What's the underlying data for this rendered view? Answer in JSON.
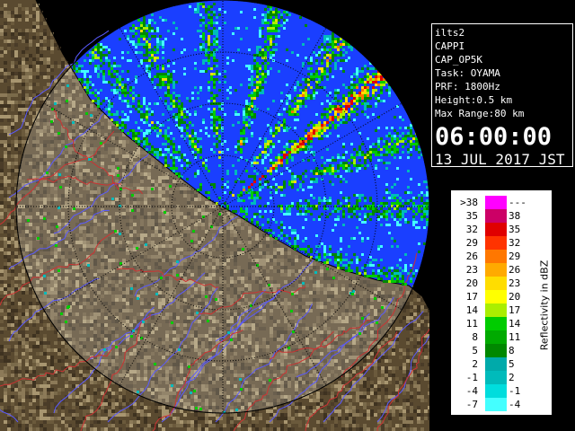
{
  "radar_site": "ilts2",
  "info_panel": {
    "lines": [
      "ilts2",
      "CAPPI",
      "CAP_OP5K",
      "Task: OYAMA",
      "PRF: 1800Hz",
      "Height:0.5 km",
      "Max Range:80 km"
    ],
    "time": "06:00:00",
    "date": "13 JUL 2017 JST"
  },
  "legend": {
    "title": "Reflectivity in dBZ",
    "bins": [
      {
        "low": ">38",
        "high": "---",
        "color": "#ff00ff"
      },
      {
        "low": "35",
        "high": "38",
        "color": "#cc0066"
      },
      {
        "low": "32",
        "high": "35",
        "color": "#e00000"
      },
      {
        "low": "29",
        "high": "32",
        "color": "#ff3300"
      },
      {
        "low": "26",
        "high": "29",
        "color": "#ff7700"
      },
      {
        "low": "23",
        "high": "26",
        "color": "#ffaa00"
      },
      {
        "low": "20",
        "high": "23",
        "color": "#ffdd00"
      },
      {
        "low": "17",
        "high": "20",
        "color": "#ffff00"
      },
      {
        "low": "14",
        "high": "17",
        "color": "#aaee00"
      },
      {
        "low": "11",
        "high": "14",
        "color": "#00cc00"
      },
      {
        "low": "8",
        "high": "11",
        "color": "#00aa00"
      },
      {
        "low": "5",
        "high": "8",
        "color": "#008800"
      },
      {
        "low": "2",
        "high": "5",
        "color": "#00aaaa"
      },
      {
        "low": "-1",
        "high": "2",
        "color": "#00bbbb"
      },
      {
        "low": "-4",
        "high": "-1",
        "color": "#00dddd"
      },
      {
        "low": "-7",
        "high": "-4",
        "color": "#44ffff"
      }
    ]
  },
  "colors": {
    "sea_background": "#1a3fff",
    "land_dark": "#5a4a30",
    "land_light": "#a89670",
    "range_ring": "#000000",
    "river": "#5a5aff",
    "border": "#cc3333",
    "echo_weak": "#00ccdd",
    "echo_mid": "#00cc00",
    "echo_strong": "#ffcc00"
  }
}
